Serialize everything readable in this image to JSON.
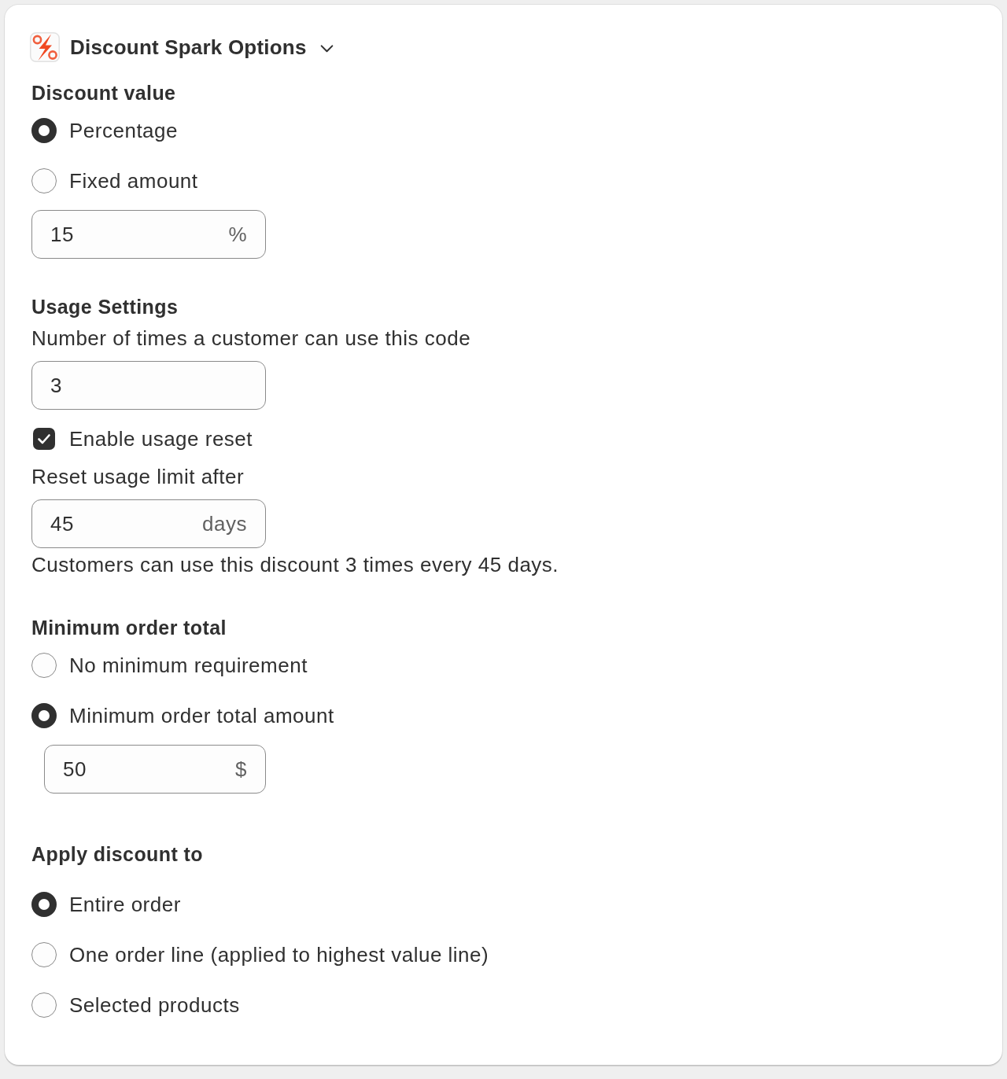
{
  "header": {
    "title": "Discount Spark Options"
  },
  "discount_value": {
    "heading": "Discount value",
    "options": [
      {
        "label": "Percentage",
        "selected": true
      },
      {
        "label": "Fixed amount",
        "selected": false
      }
    ],
    "field": {
      "value": "15",
      "suffix": "%"
    }
  },
  "usage_settings": {
    "heading": "Usage Settings",
    "limit_label": "Number of times a customer can use this code",
    "limit_field": {
      "value": "3"
    },
    "reset_checkbox": {
      "label": "Enable usage reset",
      "checked": true
    },
    "reset_label": "Reset usage limit after",
    "reset_field": {
      "value": "45",
      "suffix": "days"
    },
    "summary": "Customers can use this discount 3 times every 45 days."
  },
  "minimum_order_total": {
    "heading": "Minimum order total",
    "options": [
      {
        "label": "No minimum requirement",
        "selected": false
      },
      {
        "label": "Minimum order total amount",
        "selected": true
      }
    ],
    "field": {
      "value": "50",
      "suffix": "$"
    }
  },
  "apply_discount_to": {
    "heading": "Apply discount to",
    "options": [
      {
        "label": "Entire order",
        "selected": true
      },
      {
        "label": "One order line (applied to highest value line)",
        "selected": false
      },
      {
        "label": "Selected products",
        "selected": false
      }
    ]
  }
}
